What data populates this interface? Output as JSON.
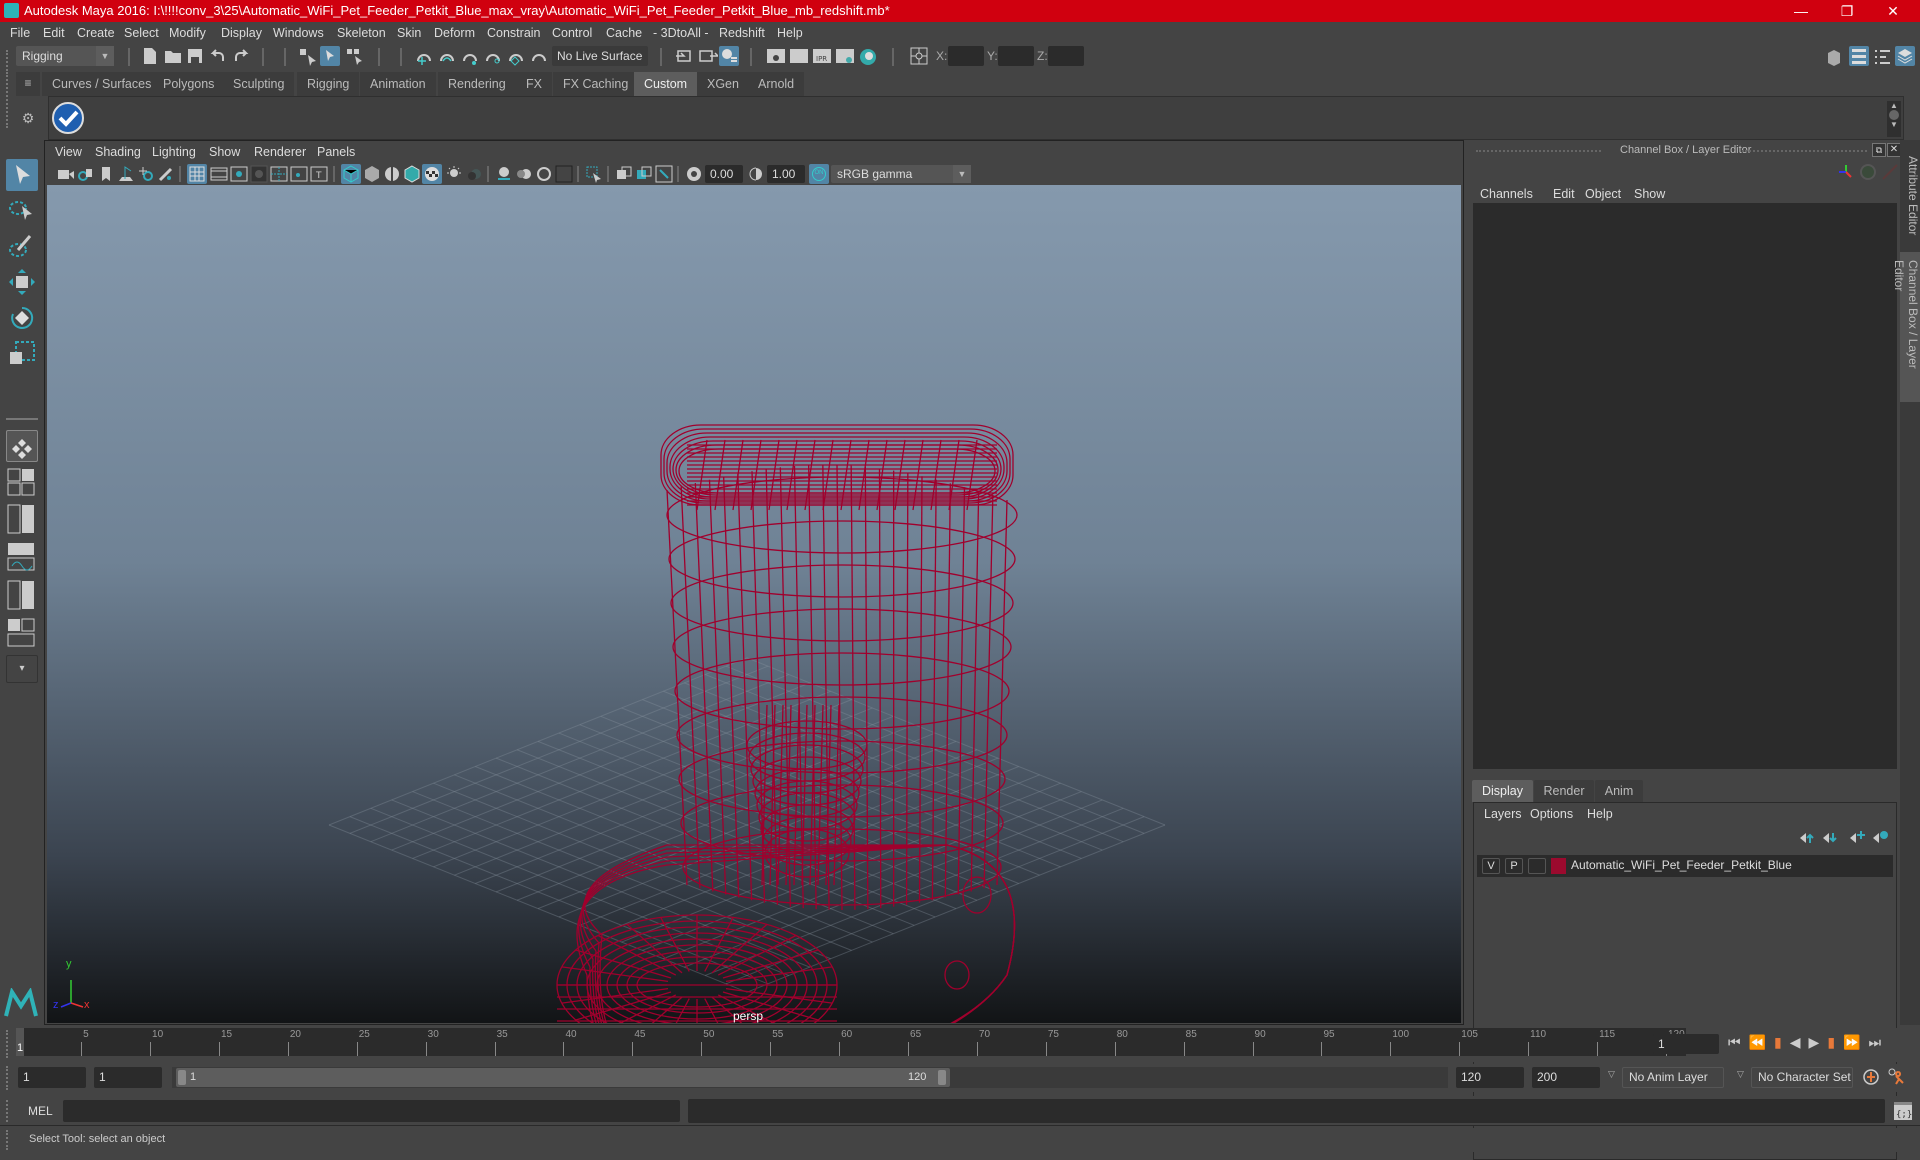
{
  "window": {
    "title": "Autodesk Maya 2016: I:\\!!!!conv_3\\25\\Automatic_WiFi_Pet_Feeder_Petkit_Blue_max_vray\\Automatic_WiFi_Pet_Feeder_Petkit_Blue_mb_redshift.mb*",
    "controls": [
      "minimize-icon",
      "maximize-icon",
      "close-icon"
    ]
  },
  "menubar": [
    "File",
    "Edit",
    "Create",
    "Select",
    "Modify",
    "Display",
    "Windows",
    "Skeleton",
    "Skin",
    "Deform",
    "Constrain",
    "Control",
    "Cache",
    "- 3DtoAll -",
    "Redshift",
    "Help"
  ],
  "statusline": {
    "menu_set": "Rigging",
    "live_surface": "No Live Surface",
    "x_label": "X:",
    "y_label": "Y:",
    "z_label": "Z:",
    "x_value": "",
    "y_value": "",
    "z_value": ""
  },
  "shelf": {
    "tabs": [
      "Curves / Surfaces",
      "Polygons",
      "Sculpting",
      "Rigging",
      "Animation",
      "Rendering",
      "FX",
      "FX Caching",
      "Custom",
      "XGen",
      "Arnold"
    ],
    "active_tab": "Custom",
    "items": [
      "checkmark-shelf-icon"
    ]
  },
  "viewport": {
    "menu": [
      "View",
      "Shading",
      "Lighting",
      "Show",
      "Renderer",
      "Panels"
    ],
    "exposure": "0.00",
    "gamma": "1.00",
    "color_mgmt_badge": "ON",
    "color_space": "sRGB gamma",
    "camera_label": "persp",
    "axis": {
      "x": "x",
      "y": "y",
      "z": "z"
    },
    "wire_color": "#a0002d",
    "bg_top": "#8599ad",
    "bg_bottom": "#121416"
  },
  "channel_box": {
    "title": "Channel Box / Layer Editor",
    "menu": [
      "Channels",
      "Edit",
      "Object",
      "Show"
    ]
  },
  "layer_editor": {
    "tabs": [
      "Display",
      "Render",
      "Anim"
    ],
    "active_tab": "Display",
    "menu": [
      "Layers",
      "Options",
      "Help"
    ],
    "layers": [
      {
        "v": "V",
        "p": "P",
        "color": "#9b0a2e",
        "name": "Automatic_WiFi_Pet_Feeder_Petkit_Blue"
      }
    ]
  },
  "side_tabs": [
    "Attribute Editor",
    "Channel Box / Layer Editor"
  ],
  "timeline": {
    "ticks": [
      "5",
      "10",
      "15",
      "20",
      "25",
      "30",
      "35",
      "40",
      "45",
      "50",
      "55",
      "60",
      "65",
      "70",
      "75",
      "80",
      "85",
      "90",
      "95",
      "100",
      "105",
      "110",
      "115",
      "120"
    ],
    "current_frame_marker": "1",
    "current_frame": "1",
    "start": 1,
    "end": 120
  },
  "range": {
    "anim_start": "1",
    "playback_start": "1",
    "slider_start": "1",
    "slider_end": "120",
    "playback_end": "120",
    "anim_end": "200",
    "anim_layer": "No Anim Layer",
    "character_set": "No Character Set"
  },
  "command_line": {
    "label": "MEL",
    "value": "",
    "result": ""
  },
  "help_line": "Select Tool: select an object",
  "accent": "#5285a6",
  "title_color": "#d0000f"
}
